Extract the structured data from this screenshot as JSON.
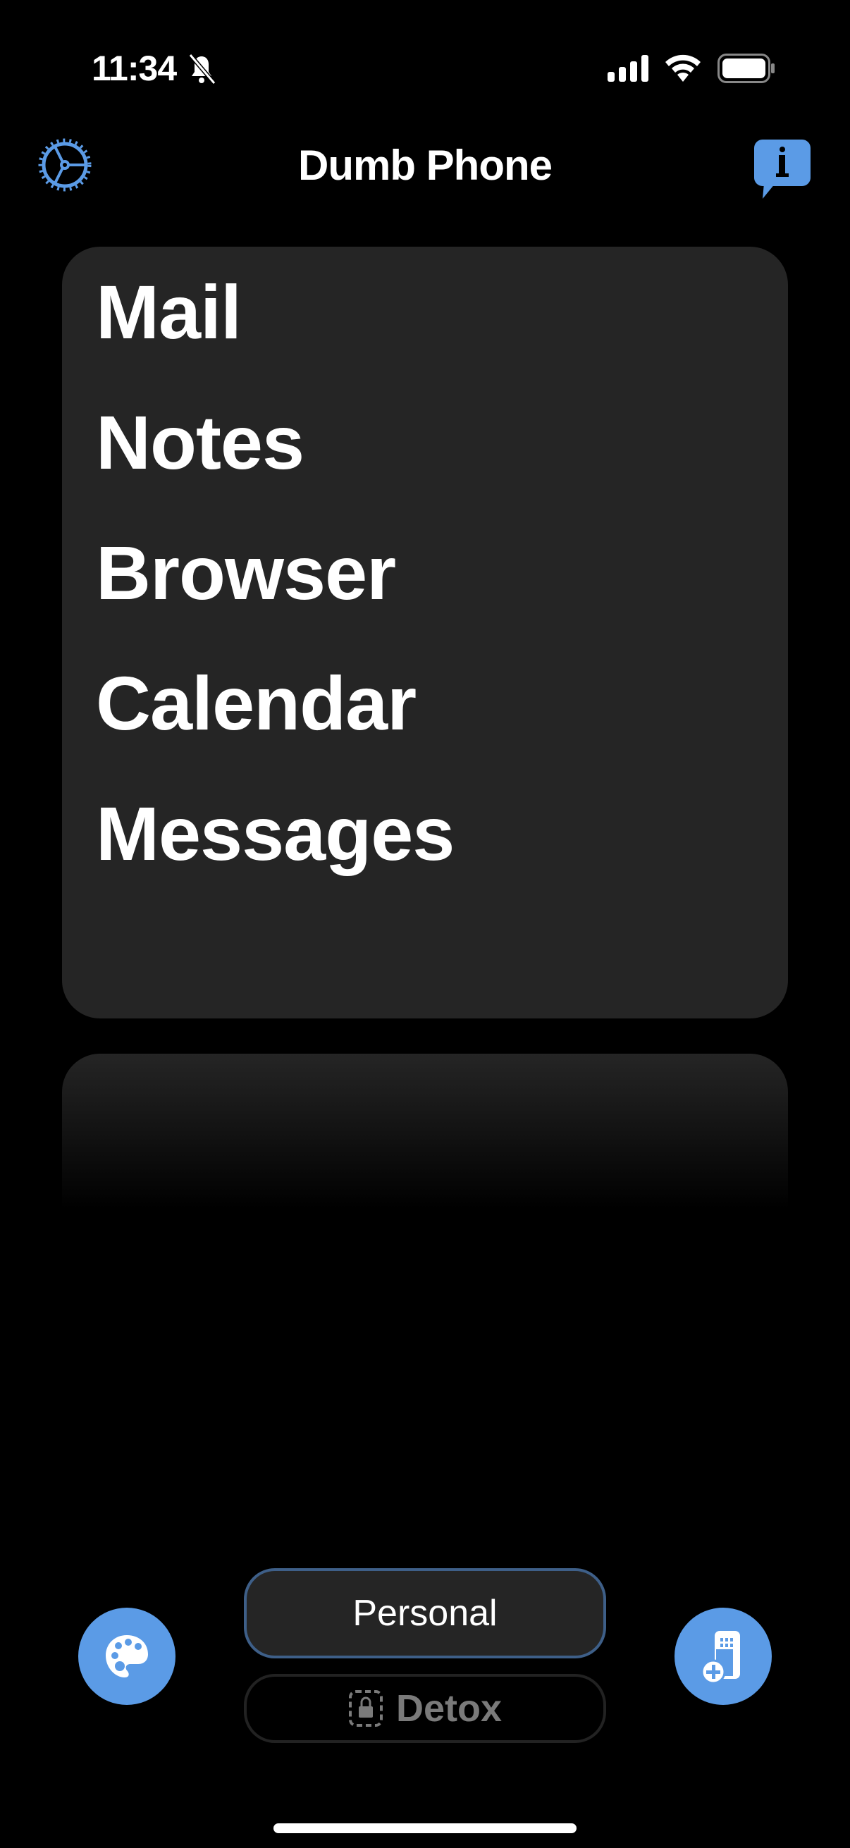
{
  "status_bar": {
    "time": "11:34",
    "silent": true
  },
  "header": {
    "title": "Dumb Phone",
    "settings_icon": "gear-icon",
    "info_icon": "info-bubble-icon"
  },
  "apps": [
    "Mail",
    "Notes",
    "Browser",
    "Calendar",
    "Messages"
  ],
  "modes": {
    "active": "Personal",
    "locked": "Detox"
  },
  "bottom": {
    "left_icon": "palette-icon",
    "right_icon": "add-app-icon"
  },
  "colors": {
    "accent": "#5B9BE6",
    "card": "#252525",
    "active_border": "#3E5F88"
  }
}
